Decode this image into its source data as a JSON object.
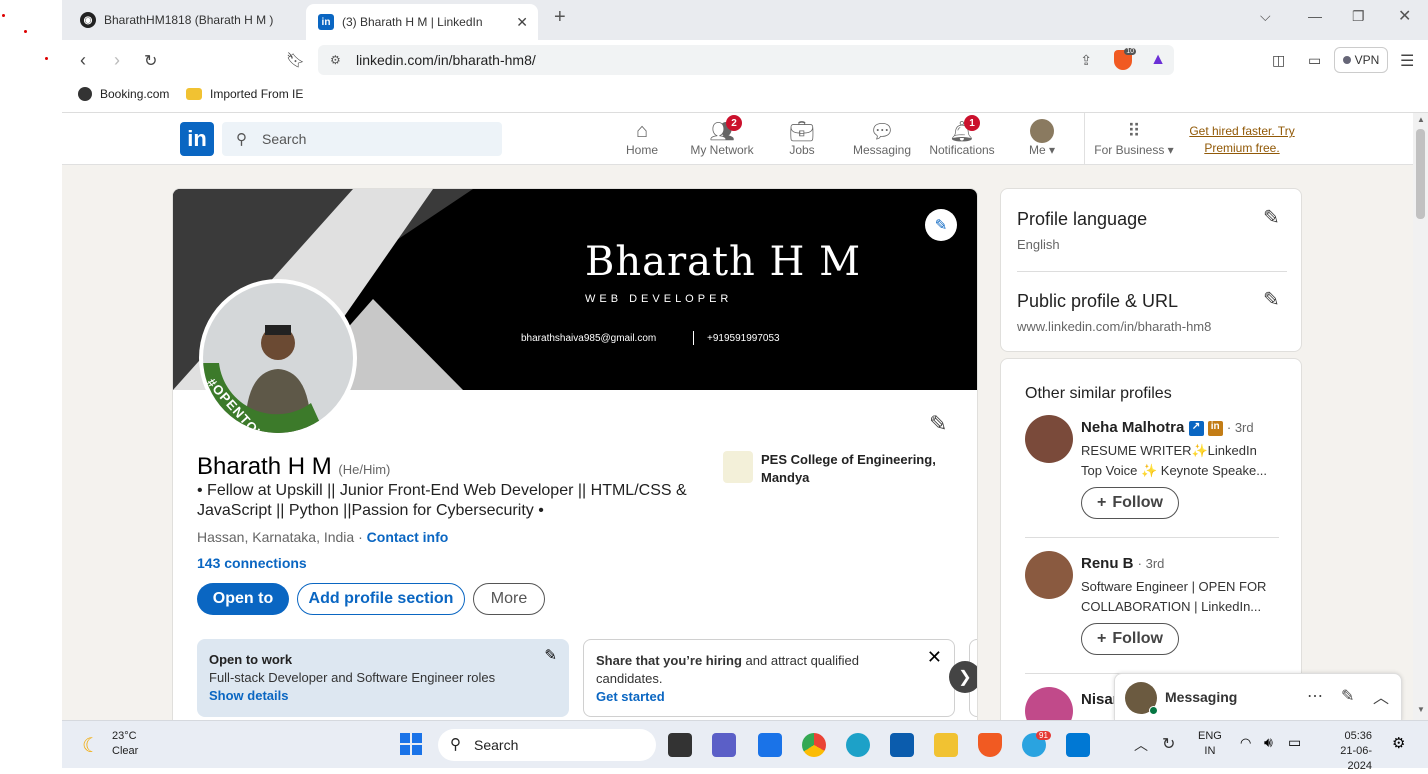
{
  "browser": {
    "tabs": [
      {
        "title": "BharathHM1818 (Bharath H M )"
      },
      {
        "title": "(3) Bharath H M | LinkedIn"
      }
    ],
    "url": "linkedin.com/in/bharath-hm8/",
    "shield_count": "10",
    "vpn_label": "VPN",
    "bookmarks": [
      "Booking.com",
      "Imported From IE"
    ]
  },
  "linkedin": {
    "search_placeholder": "Search",
    "nav": [
      {
        "label": "Home",
        "icon": "home-icon"
      },
      {
        "label": "My Network",
        "icon": "network-icon",
        "badge": "2"
      },
      {
        "label": "Jobs",
        "icon": "briefcase-icon"
      },
      {
        "label": "Messaging",
        "icon": "chat-icon"
      },
      {
        "label": "Notifications",
        "icon": "bell-icon",
        "badge": "1"
      },
      {
        "label": "Me",
        "icon": "avatar-icon"
      },
      {
        "label": "For Business",
        "icon": "grid-icon"
      }
    ],
    "promo": "Get hired faster. Try Premium free.",
    "banner": {
      "name": "Bharath H M",
      "role": "WEB DEVELOPER",
      "email": "bharathshaiva985@gmail.com",
      "phone": "+919591997053"
    },
    "frame_text": "#OPENTOWORK",
    "profile": {
      "name": "Bharath H M",
      "pronouns": "(He/Him)",
      "headline": "• Fellow at Upskill || Junior Front-End Web Developer || HTML/CSS & JavaScript || Python ||Passion for Cybersecurity •",
      "location": "Hassan, Karnataka, India",
      "contact": "Contact info",
      "connections": "143 connections",
      "education": "PES College of Engineering, Mandya"
    },
    "buttons": {
      "open_to": "Open to",
      "add_section": "Add profile section",
      "more": "More"
    },
    "open_to_work": {
      "title": "Open to work",
      "roles": "Full-stack Developer and Software Engineer roles",
      "link": "Show details"
    },
    "hiring": {
      "bold": "Share that you’re hiring",
      "rest": " and attract qualified candidates.",
      "link": "Get started"
    },
    "sidebar": {
      "lang_title": "Profile language",
      "lang_value": "English",
      "url_title": "Public profile & URL",
      "url_value": "www.linkedin.com/in/bharath-hm8"
    },
    "similar": {
      "title": "Other similar profiles",
      "people": [
        {
          "name": "Neha Malhotra",
          "degree": "· 3rd",
          "line1": "RESUME WRITER✨LinkedIn",
          "line2": "Top Voice ✨ Keynote Speake...",
          "follow": "Follow"
        },
        {
          "name": "Renu B",
          "degree": "· 3rd",
          "line1": "Software Engineer | OPEN FOR",
          "line2": "COLLABORATION | LinkedIn...",
          "follow": "Follow"
        },
        {
          "name": "Nisar",
          "degree": "",
          "line1": "",
          "line2": "",
          "follow": ""
        }
      ]
    },
    "messaging": "Messaging"
  },
  "taskbar": {
    "temp": "23°C",
    "weather": "Clear",
    "search": "Search",
    "lang1": "ENG",
    "lang2": "IN",
    "time": "05:36",
    "date": "21-06-2024",
    "telegram_badge": "91"
  },
  "colors": {
    "linkedin_blue": "#0a66c2",
    "badge_red": "#cb112d",
    "opentowork_green": "#3c7a2a"
  }
}
